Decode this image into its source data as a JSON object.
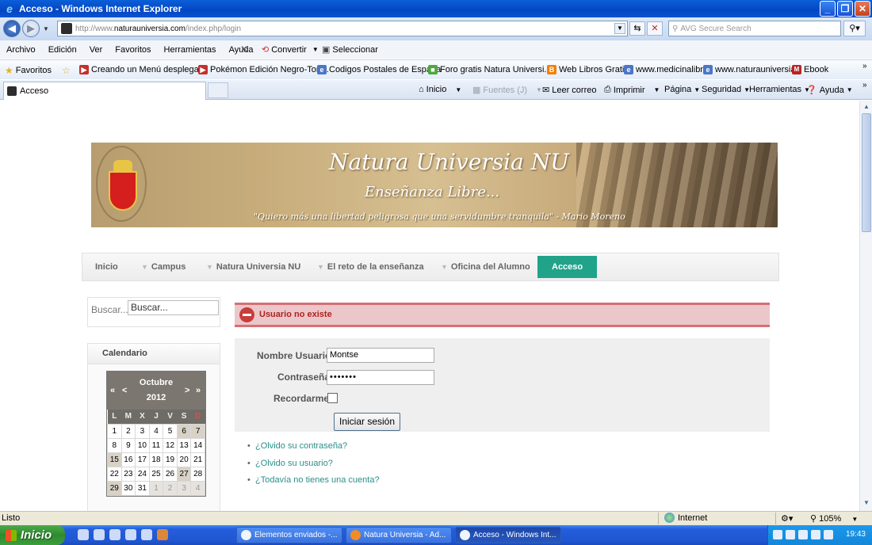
{
  "window": {
    "title": "Acceso - Windows Internet Explorer",
    "btn_min": "_",
    "btn_max": "❐",
    "btn_close": "✕"
  },
  "addressbar": {
    "url_prefix": "http://www.",
    "url_domain": "naturauniversia.com",
    "url_path": "/index.php/login",
    "search_placeholder": "AVG Secure Search"
  },
  "menu": {
    "items": [
      "Archivo",
      "Edición",
      "Ver",
      "Favoritos",
      "Herramientas",
      "Ayuda"
    ],
    "close_x": "✕",
    "convertir": "Convertir",
    "seleccionar": "Seleccionar"
  },
  "favorites": {
    "label": "Favoritos",
    "items": [
      "Creando un Menú desplega...",
      "Pokémon Edición Negro-Torr...",
      "Codigos Postales de España",
      "Foro gratis  Natura Universi...",
      "Web Libros Gratis",
      "www.medicinalibre",
      "www.naturauniversia",
      "Ebook"
    ]
  },
  "tabs": {
    "active_title": "Acceso"
  },
  "commandbar": {
    "inicio": "Inicio",
    "fuentes": "Fuentes (J)",
    "leer_correo": "Leer correo",
    "imprimir": "Imprimir",
    "pagina": "Página",
    "seguridad": "Seguridad",
    "herramientas": "Herramientas",
    "ayuda": "Ayuda"
  },
  "banner": {
    "title": "Natura Universia NU",
    "subtitle": "Enseñanza Libre...",
    "quote": "\"Quiero más una libertad peligrosa que una servidumbre tranquila\" - Mario Moreno"
  },
  "nav": {
    "items": [
      "Inicio",
      "Campus",
      "Natura Universia NU",
      "El reto de la enseñanza",
      "Oficina del Alumno"
    ],
    "active": "Acceso"
  },
  "search_module": {
    "label": "Buscar...",
    "value": "Buscar..."
  },
  "calendar": {
    "module_title": "Calendario",
    "month": "Octubre",
    "year": "2012",
    "prev_year": "«",
    "prev_month": "<",
    "next_month": ">",
    "next_year": "»",
    "weekdays": [
      "L",
      "M",
      "X",
      "J",
      "V",
      "S",
      "D"
    ],
    "weeks": [
      [
        "1",
        "2",
        "3",
        "4",
        "5",
        "6",
        "7"
      ],
      [
        "8",
        "9",
        "10",
        "11",
        "12",
        "13",
        "14"
      ],
      [
        "15",
        "16",
        "17",
        "18",
        "19",
        "20",
        "21"
      ],
      [
        "22",
        "23",
        "24",
        "25",
        "26",
        "27",
        "28"
      ],
      [
        "29",
        "30",
        "31",
        "1",
        "2",
        "3",
        "4"
      ]
    ]
  },
  "alert": {
    "message": "Usuario no existe"
  },
  "login": {
    "username_label": "Nombre Usuario",
    "username_value": "Montse",
    "password_label": "Contraseña",
    "password_value": "•••••••",
    "remember_label": "Recordarme",
    "remember_checked": false,
    "submit_label": "Iniciar sesión"
  },
  "links": [
    "¿Olvido su contraseña?",
    "¿Olvido su usuario?",
    "¿Todavía no tienes una cuenta?"
  ],
  "statusbar": {
    "status": "Listo",
    "zone": "Internet",
    "zoom": "105%"
  },
  "taskbar": {
    "start": "Inicio",
    "buttons": [
      "Elementos enviados -...",
      "Natura Universia - Ad...",
      "Acceso - Windows Int..."
    ],
    "clock": "19:43"
  },
  "colors": {
    "nav_active": "#21a38a",
    "alert_bg": "#ebc7c9",
    "alert_text": "#b22222",
    "link": "#2a8f8a"
  }
}
